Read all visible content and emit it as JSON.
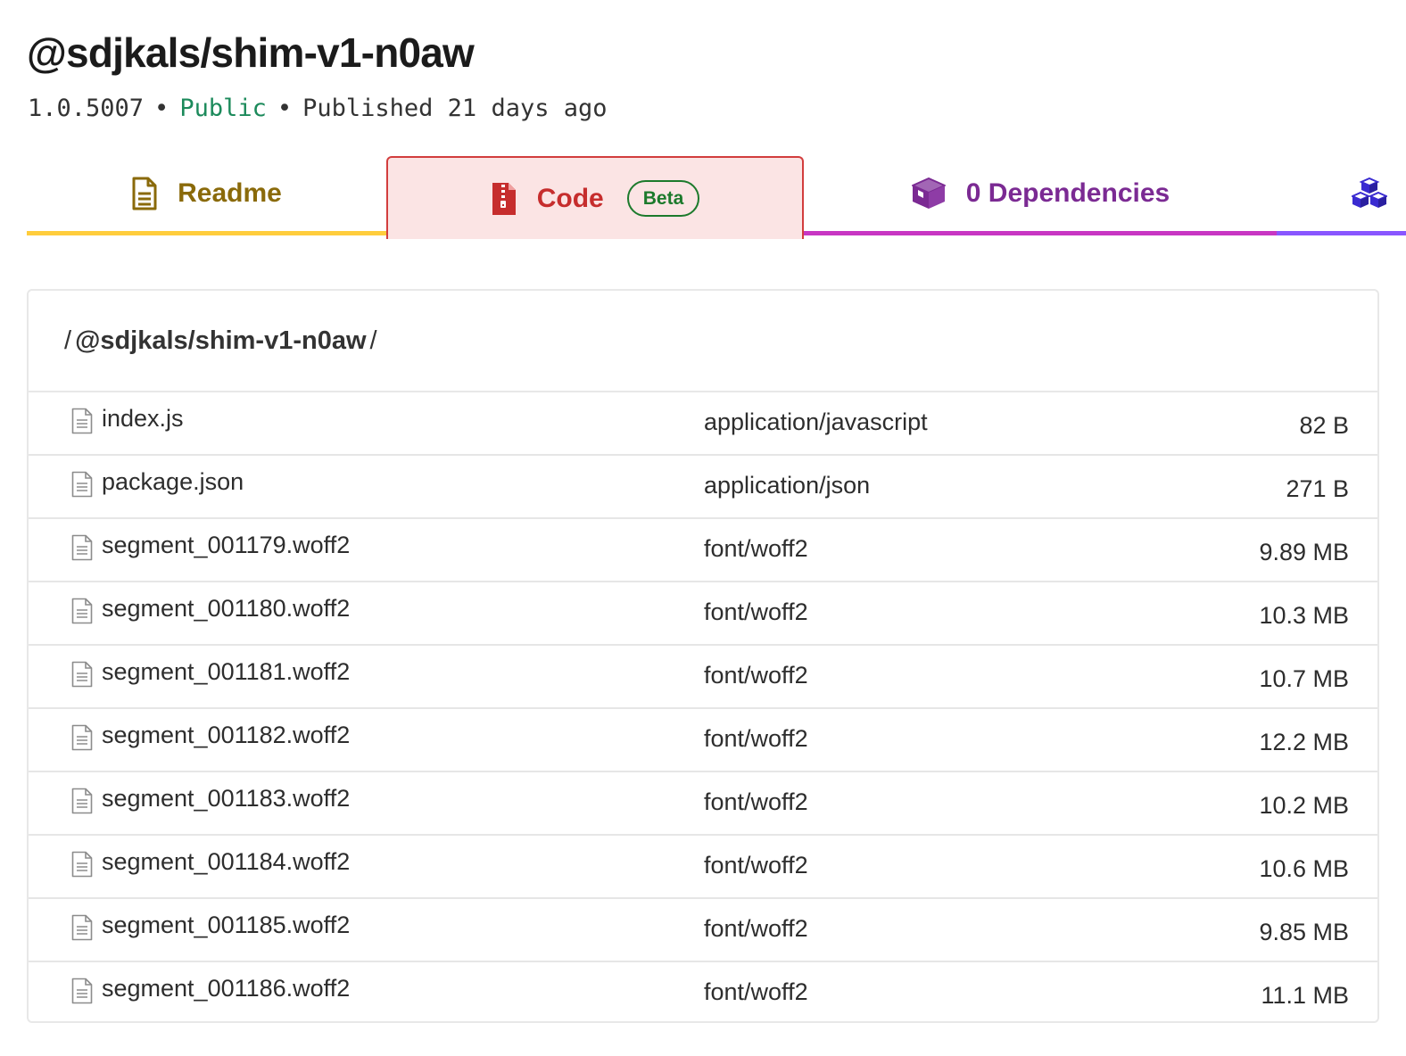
{
  "package": {
    "name": "@sdjkals/shim-v1-n0aw",
    "version": "1.0.5007",
    "visibility": "Public",
    "published": "Published 21 days ago"
  },
  "tabs": {
    "readme": {
      "label": "Readme",
      "icon": "readme-doc-icon",
      "color": "#8a6a0a"
    },
    "code": {
      "label": "Code",
      "badge": "Beta",
      "icon": "zip-file-icon",
      "color": "#c62d2d",
      "active": true
    },
    "dependencies": {
      "label": "0 Dependencies",
      "icon": "box-icon",
      "color": "#7b2a93"
    },
    "dependents": {
      "icon": "cubes-icon",
      "color": "#3a2bd1"
    }
  },
  "browser": {
    "path_segment": "@sdjkals/shim-v1-n0aw",
    "files": [
      {
        "name": "index.js",
        "type": "application/javascript",
        "size": "82 B"
      },
      {
        "name": "package.json",
        "type": "application/json",
        "size": "271 B"
      },
      {
        "name": "segment_001179.woff2",
        "type": "font/woff2",
        "size": "9.89 MB"
      },
      {
        "name": "segment_001180.woff2",
        "type": "font/woff2",
        "size": "10.3 MB"
      },
      {
        "name": "segment_001181.woff2",
        "type": "font/woff2",
        "size": "10.7 MB"
      },
      {
        "name": "segment_001182.woff2",
        "type": "font/woff2",
        "size": "12.2 MB"
      },
      {
        "name": "segment_001183.woff2",
        "type": "font/woff2",
        "size": "10.2 MB"
      },
      {
        "name": "segment_001184.woff2",
        "type": "font/woff2",
        "size": "10.6 MB"
      },
      {
        "name": "segment_001185.woff2",
        "type": "font/woff2",
        "size": "9.85 MB"
      },
      {
        "name": "segment_001186.woff2",
        "type": "font/woff2",
        "size": "11.1 MB"
      }
    ]
  },
  "colors": {
    "public": "#1c8a5b",
    "readme_underline": "#ffcd3c",
    "code_background": "#fbe4e4",
    "code_border": "#d23d3d",
    "deps_underline": "#c836c3",
    "dependents_underline": "#8956ff",
    "beta_badge": "#1c7a2c"
  }
}
